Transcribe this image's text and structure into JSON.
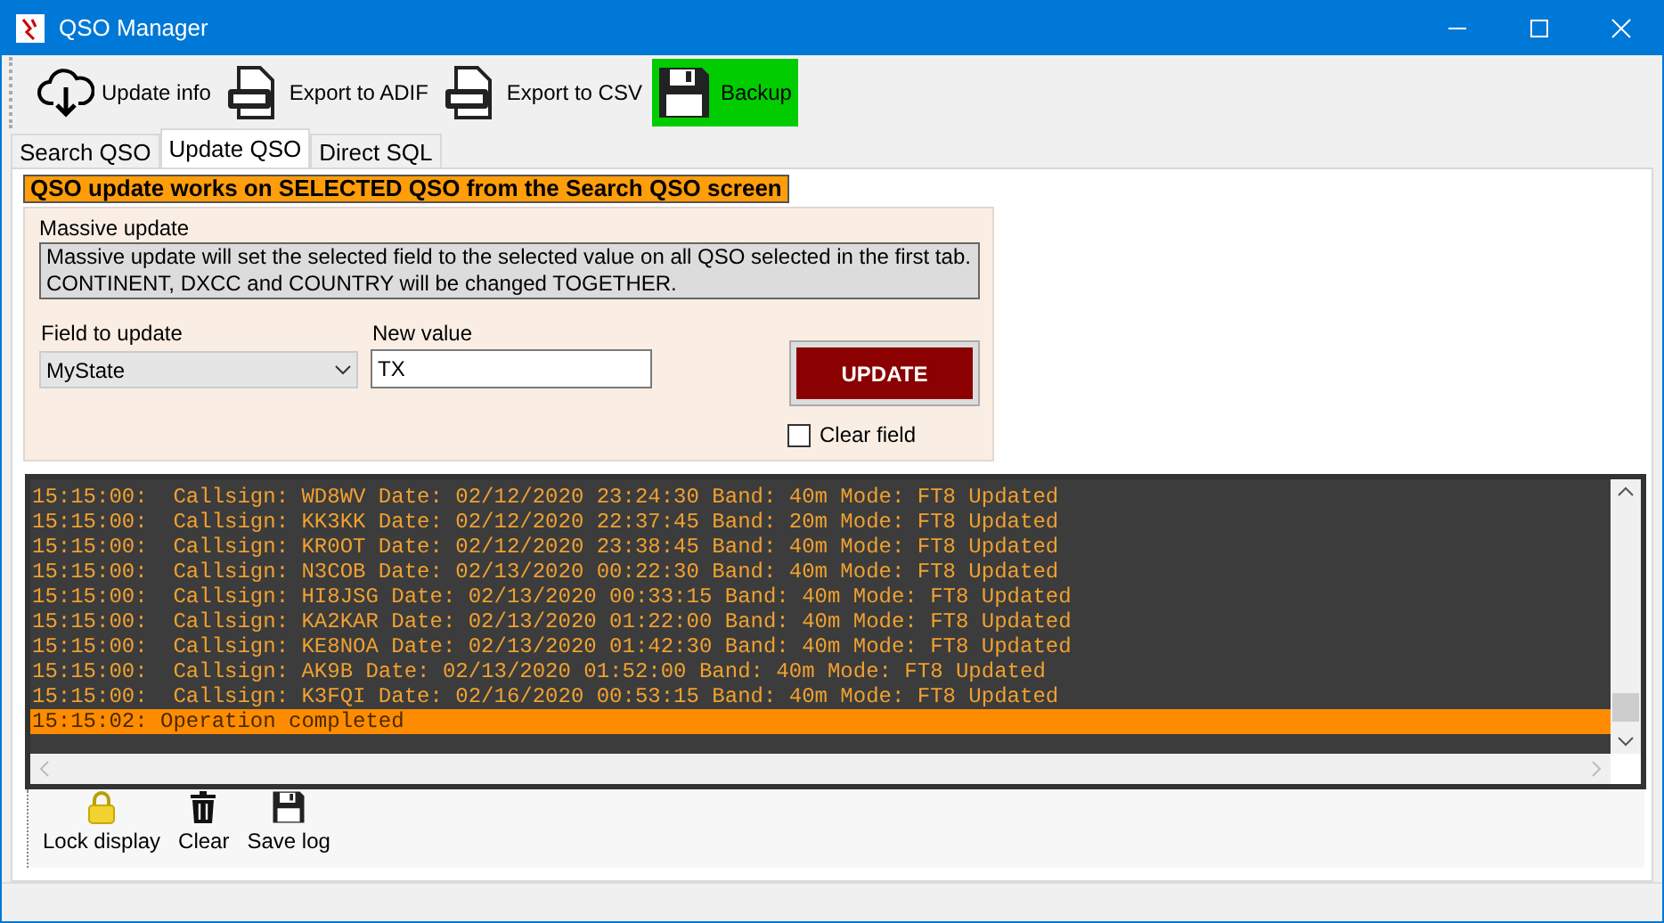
{
  "window": {
    "title": "QSO Manager"
  },
  "toolbar": [
    {
      "kind": "cloud",
      "label": "Update info",
      "highlighted": false
    },
    {
      "kind": "adif",
      "label": "Export to ADIF",
      "highlighted": false
    },
    {
      "kind": "csv",
      "label": "Export to CSV",
      "highlighted": false
    },
    {
      "kind": "floppy",
      "label": "Backup",
      "highlighted": true
    }
  ],
  "tabs": [
    {
      "label": "Search QSO",
      "selected": false
    },
    {
      "label": "Update QSO",
      "selected": true
    },
    {
      "label": "Direct SQL",
      "selected": false
    }
  ],
  "banner": "QSO update works on SELECTED QSO from the Search QSO screen",
  "massive_update": {
    "title": "Massive update",
    "description": "Massive update will set the selected field to the selected value on all QSO selected in the first tab. CONTINENT, DXCC and COUNTRY will be changed TOGETHER.",
    "field_label": "Field to update",
    "field_value": "MyState",
    "value_label": "New value",
    "value": "TX",
    "button": "UPDATE",
    "clear_field": {
      "label": "Clear field",
      "checked": false
    }
  },
  "log": [
    {
      "text": "15:15:00:  Callsign: WD8WV Date: 02/12/2020 23:24:30 Band: 40m Mode: FT8 Updated",
      "selected": false
    },
    {
      "text": "15:15:00:  Callsign: KK3KK Date: 02/12/2020 22:37:45 Band: 20m Mode: FT8 Updated",
      "selected": false
    },
    {
      "text": "15:15:00:  Callsign: KR0OT Date: 02/12/2020 23:38:45 Band: 40m Mode: FT8 Updated",
      "selected": false
    },
    {
      "text": "15:15:00:  Callsign: N3COB Date: 02/13/2020 00:22:30 Band: 40m Mode: FT8 Updated",
      "selected": false
    },
    {
      "text": "15:15:00:  Callsign: HI8JSG Date: 02/13/2020 00:33:15 Band: 40m Mode: FT8 Updated",
      "selected": false
    },
    {
      "text": "15:15:00:  Callsign: KA2KAR Date: 02/13/2020 01:22:00 Band: 40m Mode: FT8 Updated",
      "selected": false
    },
    {
      "text": "15:15:00:  Callsign: KE8NOA Date: 02/13/2020 01:42:30 Band: 40m Mode: FT8 Updated",
      "selected": false
    },
    {
      "text": "15:15:00:  Callsign: AK9B Date: 02/13/2020 01:52:00 Band: 40m Mode: FT8 Updated",
      "selected": false
    },
    {
      "text": "15:15:00:  Callsign: K3FQI Date: 02/16/2020 00:53:15 Band: 40m Mode: FT8 Updated",
      "selected": false
    },
    {
      "text": "15:15:02: Operation completed",
      "selected": true
    }
  ],
  "log_toolbar": [
    {
      "kind": "lock",
      "label": "Lock display"
    },
    {
      "kind": "trash",
      "label": "Clear"
    },
    {
      "kind": "floppy",
      "label": "Save log"
    }
  ]
}
